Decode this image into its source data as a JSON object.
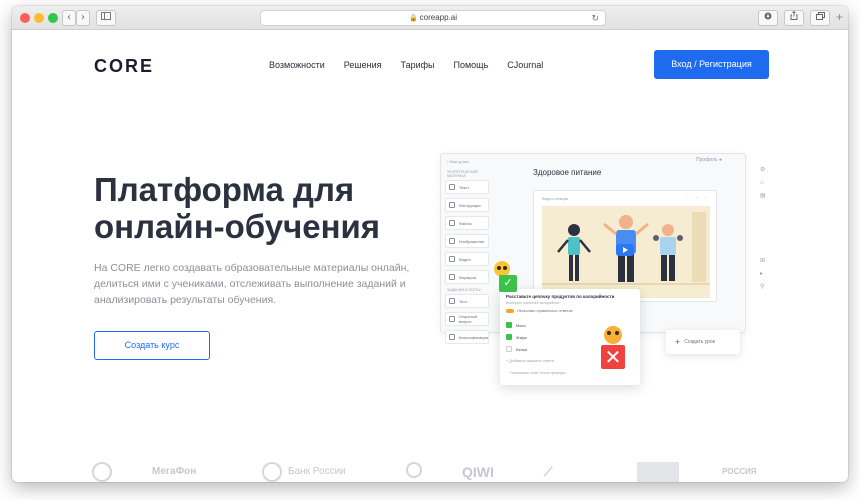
{
  "browser": {
    "url": "coreapp.ai",
    "back_glyph": "‹",
    "forward_glyph": "›",
    "new_tab_glyph": "+"
  },
  "header": {
    "logo": "CORE",
    "nav": [
      "Возможности",
      "Решения",
      "Тарифы",
      "Помощь",
      "CJournal"
    ],
    "login_button": "Вход / Регистрация"
  },
  "hero": {
    "title": "Платформа для онлайн-обучения",
    "text": "На CORE легко создавать образовательные материалы онлайн, делиться ими с учениками, отслеживать выполнение заданий и анализировать результаты обучения.",
    "cta": "Создать курс"
  },
  "mockup": {
    "back": "‹ Мои уроки",
    "profile": "Профиль",
    "course_title": "Здоровое питание",
    "card_label": "Видео-лекция",
    "sidebar_categories": [
      "ТЕОРЕТИЧЕСКИЙ МАТЕРИАЛ",
      "ЗАДАНИЯ И ТЕСТЫ"
    ],
    "sidebar_items": [
      "Текст",
      "Инструкция",
      "Файлы",
      "Изображение",
      "Видео",
      "Формулы"
    ],
    "sidebar_items_2": [
      "Тест",
      "Открытый вопрос",
      "Классификация"
    ],
    "quiz": {
      "title": "Расставьте цепочку продуктов по калорийности",
      "subtitle": "Выберите наиболее калорийные",
      "toggle_label": "Несколько правильных ответов",
      "answers": [
        {
          "label": "Мясо",
          "checked": true
        },
        {
          "label": "Жиры",
          "checked": true
        },
        {
          "label": "Белки",
          "checked": false
        }
      ],
      "add": "+ Добавить вариант ответа",
      "footer": "Показывать ответ после проверки"
    },
    "create_lesson": "Создать урок",
    "check_glyph": "✓",
    "x_glyph": "✕"
  },
  "partners": [
    "МегаФон",
    "Банк России",
    "QIWI",
    "РОССИЯ"
  ],
  "icons": {
    "lock": "lock-icon",
    "reload": "reload-icon",
    "sidebar": "sidebar-icon",
    "download": "download-icon",
    "share": "share-icon",
    "tabs": "tabs-icon"
  },
  "colors": {
    "accent": "#1f6bf0",
    "success": "#3cc14b",
    "error": "#f0423f"
  }
}
